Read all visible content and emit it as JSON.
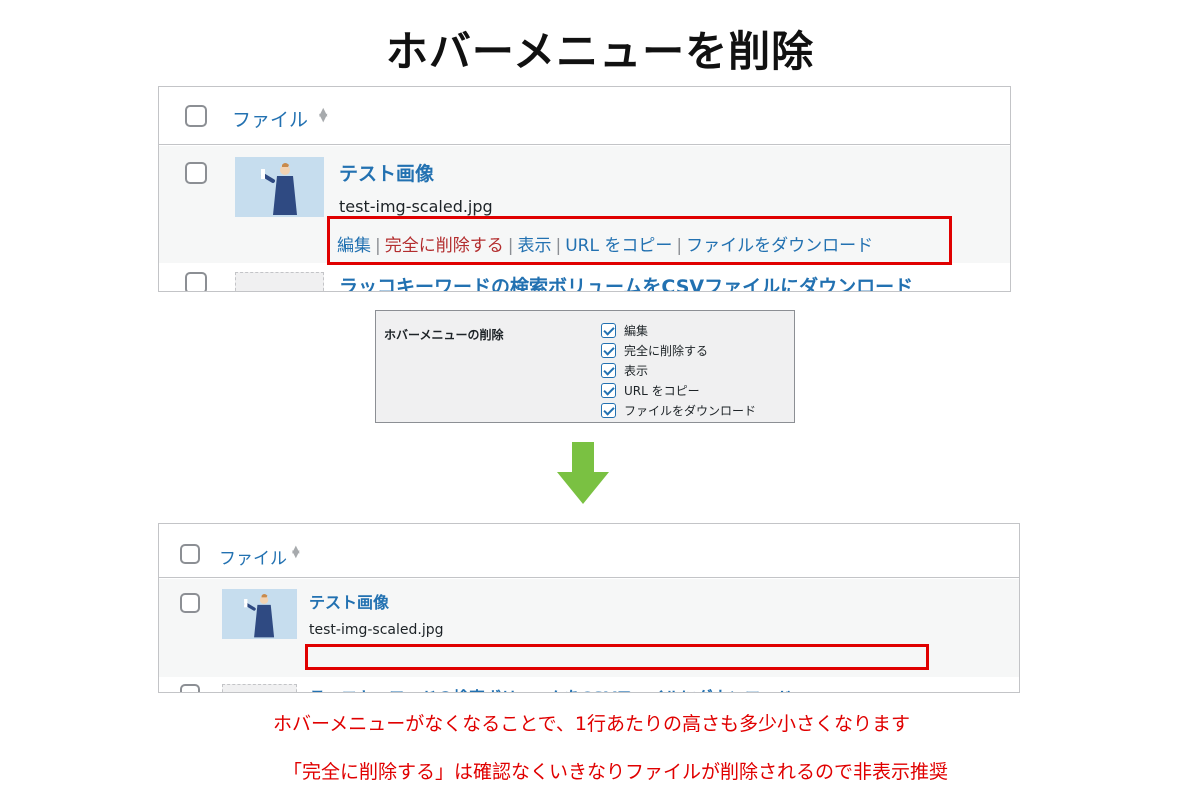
{
  "page": {
    "title": "ホバーメニューを削除"
  },
  "before": {
    "column_header": "ファイル",
    "row": {
      "title": "テスト画像",
      "filename": "test-img-scaled.jpg",
      "actions": [
        "編集",
        "完全に削除する",
        "表示",
        "URL をコピー",
        "ファイルをダウンロード"
      ]
    },
    "next_row_title": "ラッコキーワードの検索ボリュームをCSVファイルにダウンロード"
  },
  "settings": {
    "label": "ホバーメニューの削除",
    "options": [
      "編集",
      "完全に削除する",
      "表示",
      "URL をコピー",
      "ファイルをダウンロード"
    ]
  },
  "after": {
    "column_header": "ファイル",
    "row": {
      "title": "テスト画像",
      "filename": "test-img-scaled.jpg"
    },
    "next_row_title": "ラッコキーワードの検索ボリュームをCSVファイルにダウンロード"
  },
  "notes": {
    "line1": "ホバーメニューがなくなることで、1行あたりの高さも多少小さくなります",
    "line2": "「完全に削除する」は確認なくいきなりファイルが削除されるので非表示推奨"
  },
  "colors": {
    "link": "#2271b1",
    "delete_link": "#b32d2e",
    "highlight": "#e00000",
    "arrow": "#7ac142",
    "note_text": "#e00000"
  }
}
